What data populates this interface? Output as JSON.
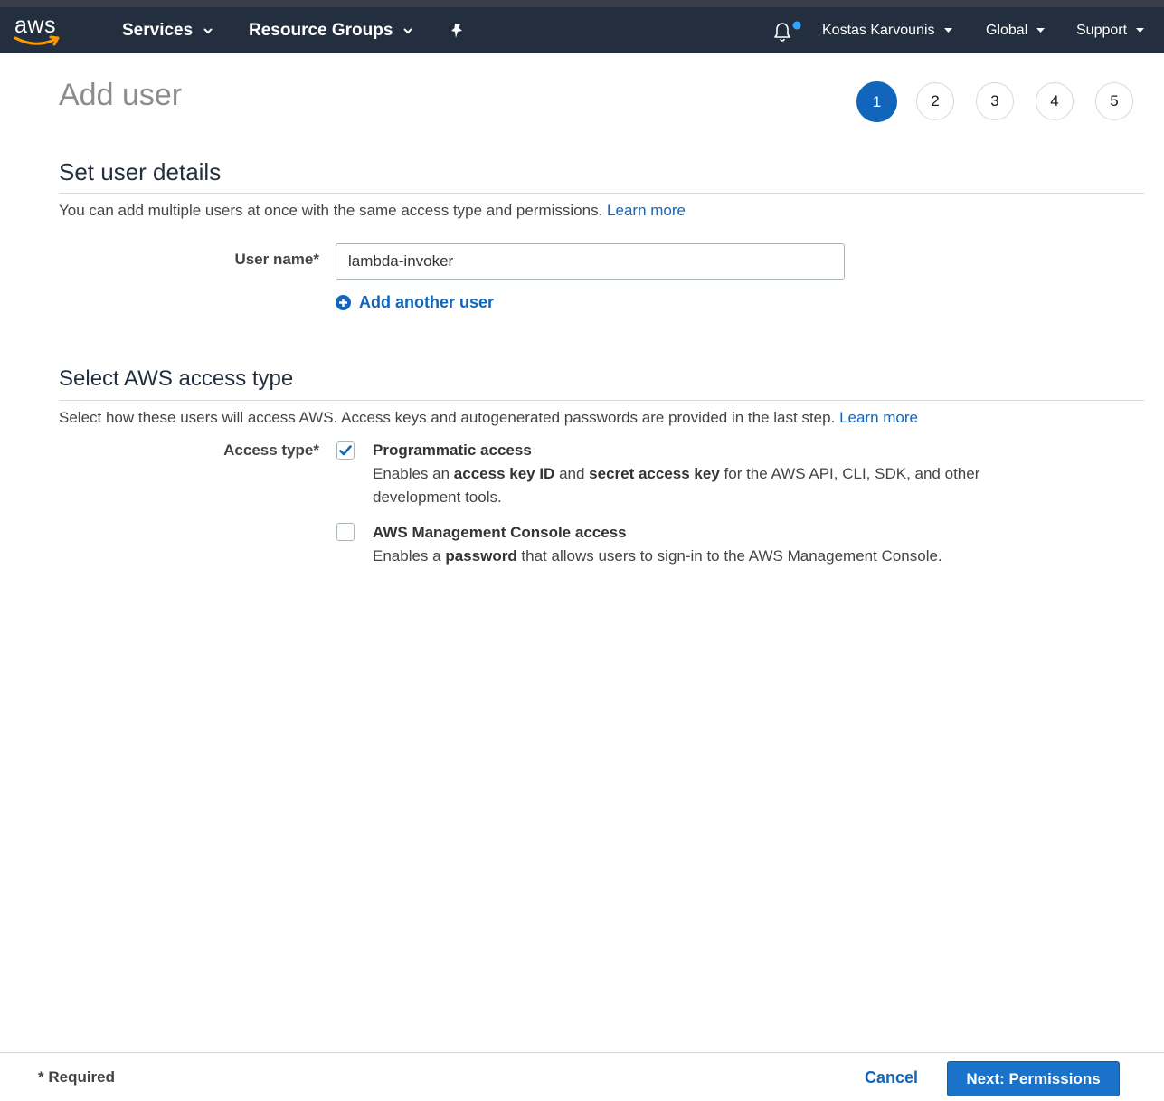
{
  "nav": {
    "logo_text": "aws",
    "services_label": "Services",
    "resource_groups_label": "Resource Groups",
    "user_label": "Kostas Karvounis",
    "region_label": "Global",
    "support_label": "Support"
  },
  "header": {
    "title": "Add user",
    "steps": [
      "1",
      "2",
      "3",
      "4",
      "5"
    ],
    "active_step": "1"
  },
  "details": {
    "title": "Set user details",
    "description": "You can add multiple users at once with the same access type and permissions.",
    "learn_more": "Learn more",
    "username_label": "User name*",
    "username_value": "lambda-invoker",
    "add_another_label": "Add another user"
  },
  "access": {
    "title": "Select AWS access type",
    "description": "Select how these users will access AWS. Access keys and autogenerated passwords are provided in the last step.",
    "learn_more": "Learn more",
    "access_type_label": "Access type*",
    "programmatic": {
      "title": "Programmatic access",
      "checked": true,
      "desc_1": "Enables an ",
      "desc_b1": "access key ID",
      "desc_2": " and ",
      "desc_b2": "secret access key",
      "desc_3": " for the AWS API, CLI, SDK, and other development tools."
    },
    "console": {
      "title": "AWS Management Console access",
      "checked": false,
      "desc_1": "Enables a ",
      "desc_b1": "password",
      "desc_2": " that allows users to sign-in to the AWS Management Console."
    }
  },
  "footer": {
    "required_note": "* Required",
    "cancel_label": "Cancel",
    "next_label": "Next: Permissions"
  },
  "colors": {
    "nav_bg": "#232f3e",
    "accent": "#1166bb",
    "smile": "#ff9900",
    "notify_dot": "#2ea6ff"
  }
}
